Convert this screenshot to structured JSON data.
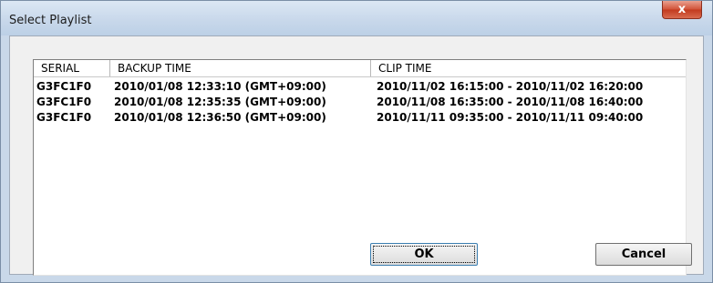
{
  "window": {
    "title": "Select Playlist",
    "close_glyph": "x"
  },
  "list": {
    "columns": [
      "SERIAL",
      "BACKUP TIME",
      "CLIP TIME"
    ],
    "rows": [
      [
        "G3FC1F0",
        "2010/01/08 12:33:10 (GMT+09:00)",
        "2010/11/02 16:15:00 - 2010/11/02 16:20:00"
      ],
      [
        "G3FC1F0",
        "2010/01/08 12:35:35 (GMT+09:00)",
        "2010/11/08 16:35:00 - 2010/11/08 16:40:00"
      ],
      [
        "G3FC1F0",
        "2010/01/08 12:36:50 (GMT+09:00)",
        "2010/11/11 09:35:00 - 2010/11/11 09:40:00"
      ]
    ]
  },
  "buttons": {
    "ok_label": "OK",
    "cancel_label": "Cancel"
  },
  "colors": {
    "title_bar": "#c7d7ea",
    "close_button": "#d2543a",
    "dialog_face": "#f0f0f0",
    "focus_border": "#3c7fb1"
  }
}
